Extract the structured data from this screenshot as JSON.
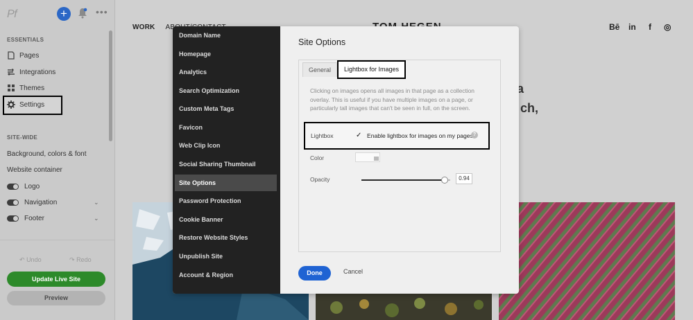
{
  "editor": {
    "logo": "Pf",
    "essentials_heading": "ESSENTIALS",
    "essentials": [
      {
        "label": "Pages",
        "icon": "pages-icon"
      },
      {
        "label": "Integrations",
        "icon": "integrations-icon"
      },
      {
        "label": "Themes",
        "icon": "themes-icon"
      },
      {
        "label": "Settings",
        "icon": "gear-icon"
      }
    ],
    "sitewide_heading": "SITE-WIDE",
    "sitewide": [
      "Background, colors & font",
      "Website container"
    ],
    "toggles": [
      {
        "label": "Logo",
        "on": true
      },
      {
        "label": "Navigation",
        "on": true
      },
      {
        "label": "Footer",
        "on": true
      }
    ],
    "undo": "Undo",
    "redo": "Redo",
    "update_button": "Update Live Site",
    "preview_button": "Preview",
    "accent_color": "#2b67c6",
    "update_color": "#2d8a2a"
  },
  "site": {
    "nav": [
      "WORK",
      "ABOUT/CONTACT"
    ],
    "title": "TOM HEGEN",
    "social": [
      "Bē",
      "in",
      "f",
      "◎"
    ],
    "hero_fragment_1": "a",
    "hero_fragment_2": "ch,"
  },
  "modal": {
    "menu": [
      "Domain Name",
      "Homepage",
      "Analytics",
      "Search Optimization",
      "Custom Meta Tags",
      "Favicon",
      "Web Clip Icon",
      "Social Sharing Thumbnail",
      "Site Options",
      "Password Protection",
      "Cookie Banner",
      "Restore Website Styles",
      "Unpublish Site",
      "Account & Region"
    ],
    "active_menu": "Site Options",
    "title": "Site Options",
    "tabs": [
      "General",
      "Lightbox for Images"
    ],
    "active_tab": "Lightbox for Images",
    "description": "Clicking on images opens all images in that page as a collection overlay. This is useful if you have multiple images on a page, or particularly tall images that can't be seen in full, on the screen.",
    "lightbox_label": "Lightbox",
    "lightbox_checkbox_label": "Enable lightbox for images on my pages",
    "lightbox_checked": true,
    "color_label": "Color",
    "opacity_label": "Opacity",
    "opacity_value": "0.94",
    "opacity_fraction": 0.94,
    "done_button": "Done",
    "cancel_button": "Cancel",
    "done_color": "#1f63d3"
  }
}
